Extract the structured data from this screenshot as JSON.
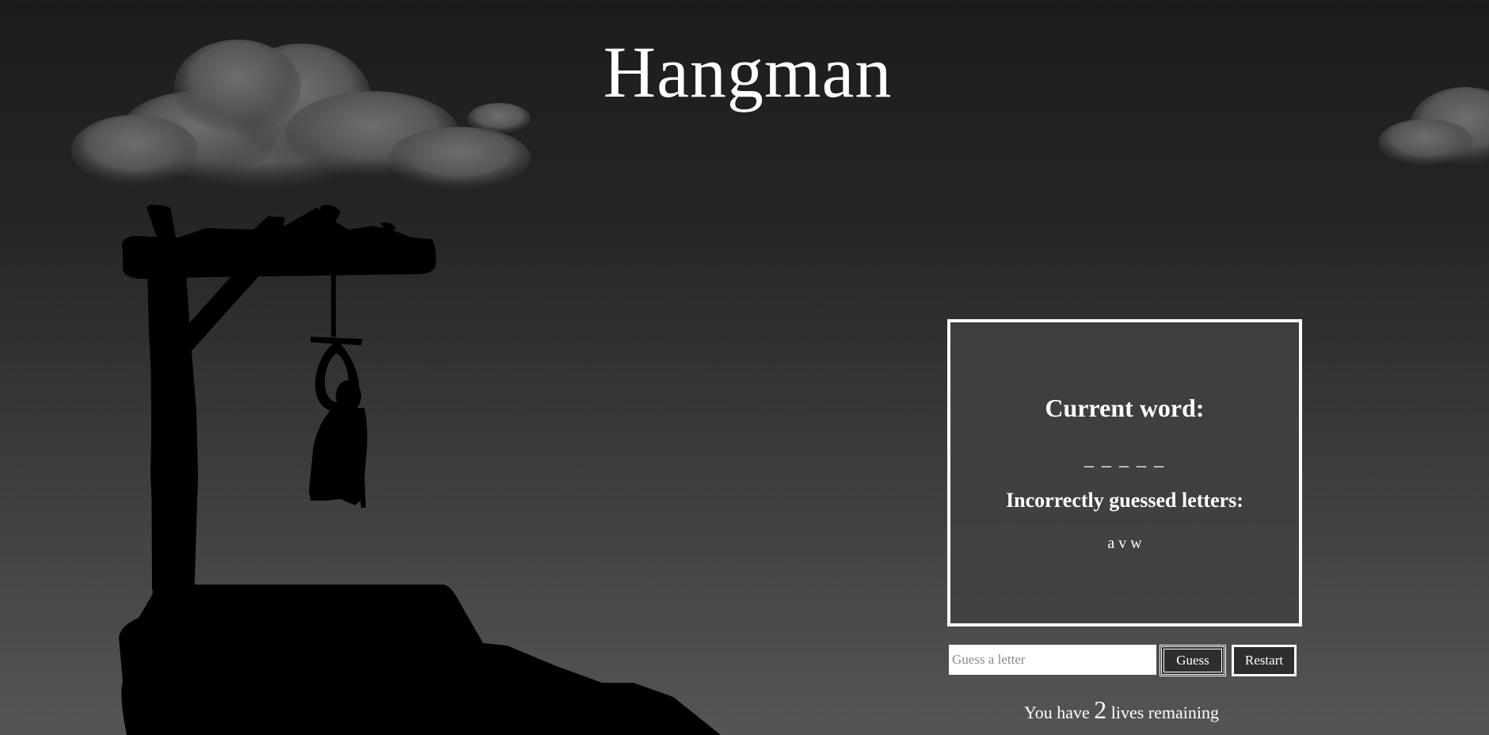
{
  "page": {
    "title": "Hangman"
  },
  "panel": {
    "current_word_label": "Current word:",
    "current_word": "_ _ _ _ _",
    "incorrect_label": "Incorrectly guessed letters:",
    "incorrect_letters": "a v w"
  },
  "controls": {
    "guess_placeholder": "Guess a letter",
    "guess_value": "",
    "guess_button_label": "Guess",
    "restart_button_label": "Restart"
  },
  "status": {
    "lives_prefix": "You have",
    "lives_count": "2",
    "lives_suffix": "lives remaining"
  },
  "colors": {
    "background_top": "#1c1c1c",
    "background_bottom": "#555555",
    "silhouette": "#000000",
    "text": "#ffffff",
    "panel_border": "#ffffff"
  },
  "icons": {
    "scene": "gallows-silhouette",
    "figure": "hanged-figure-silhouette",
    "cloud": "cloud"
  }
}
